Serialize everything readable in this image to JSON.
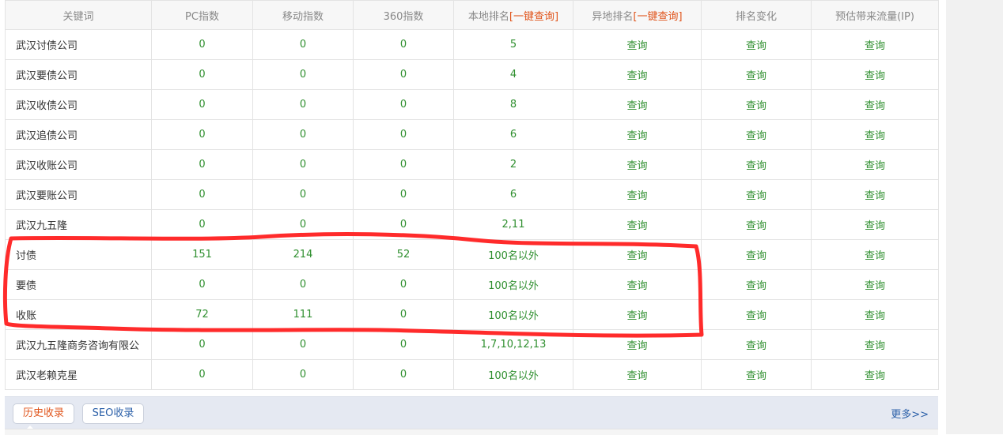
{
  "table": {
    "headers": {
      "keyword": "关键词",
      "pc_index": "PC指数",
      "mobile_index": "移动指数",
      "index_360": "360指数",
      "local_rank_label": "本地排名",
      "local_rank_link": "[一键查询]",
      "remote_rank_label": "异地排名",
      "remote_rank_link": "[一键查询]",
      "rank_change": "排名变化",
      "traffic": "预估带来流量(IP)"
    },
    "rows": [
      {
        "keyword": "武汉讨债公司",
        "pc": "0",
        "mobile": "0",
        "i360": "0",
        "local": "5",
        "remote": "查询",
        "change": "查询",
        "traffic": "查询"
      },
      {
        "keyword": "武汉要债公司",
        "pc": "0",
        "mobile": "0",
        "i360": "0",
        "local": "4",
        "remote": "查询",
        "change": "查询",
        "traffic": "查询"
      },
      {
        "keyword": "武汉收债公司",
        "pc": "0",
        "mobile": "0",
        "i360": "0",
        "local": "8",
        "remote": "查询",
        "change": "查询",
        "traffic": "查询"
      },
      {
        "keyword": "武汉追债公司",
        "pc": "0",
        "mobile": "0",
        "i360": "0",
        "local": "6",
        "remote": "查询",
        "change": "查询",
        "traffic": "查询"
      },
      {
        "keyword": "武汉收账公司",
        "pc": "0",
        "mobile": "0",
        "i360": "0",
        "local": "2",
        "remote": "查询",
        "change": "查询",
        "traffic": "查询"
      },
      {
        "keyword": "武汉要账公司",
        "pc": "0",
        "mobile": "0",
        "i360": "0",
        "local": "6",
        "remote": "查询",
        "change": "查询",
        "traffic": "查询"
      },
      {
        "keyword": "武汉九五隆",
        "pc": "0",
        "mobile": "0",
        "i360": "0",
        "local": "2,11",
        "remote": "查询",
        "change": "查询",
        "traffic": "查询"
      },
      {
        "keyword": "讨债",
        "pc": "151",
        "mobile": "214",
        "i360": "52",
        "local": "100名以外",
        "remote": "查询",
        "change": "查询",
        "traffic": "查询"
      },
      {
        "keyword": "要债",
        "pc": "0",
        "mobile": "0",
        "i360": "0",
        "local": "100名以外",
        "remote": "查询",
        "change": "查询",
        "traffic": "查询"
      },
      {
        "keyword": "收账",
        "pc": "72",
        "mobile": "111",
        "i360": "0",
        "local": "100名以外",
        "remote": "查询",
        "change": "查询",
        "traffic": "查询"
      },
      {
        "keyword": "武汉九五隆商务咨询有限公",
        "pc": "0",
        "mobile": "0",
        "i360": "0",
        "local": "1,7,10,12,13",
        "remote": "查询",
        "change": "查询",
        "traffic": "查询"
      },
      {
        "keyword": "武汉老赖克星",
        "pc": "0",
        "mobile": "0",
        "i360": "0",
        "local": "100名以外",
        "remote": "查询",
        "change": "查询",
        "traffic": "查询"
      }
    ]
  },
  "bottom_tabs": {
    "history_label": "历史收录",
    "seo_label": "SEO收录",
    "more_label": "更多>>"
  },
  "colors": {
    "value_green": "#2f8f2f",
    "accent_orange": "#e0541b",
    "link_blue": "#2a5fa8",
    "annotation_red": "#ff2b2b"
  }
}
